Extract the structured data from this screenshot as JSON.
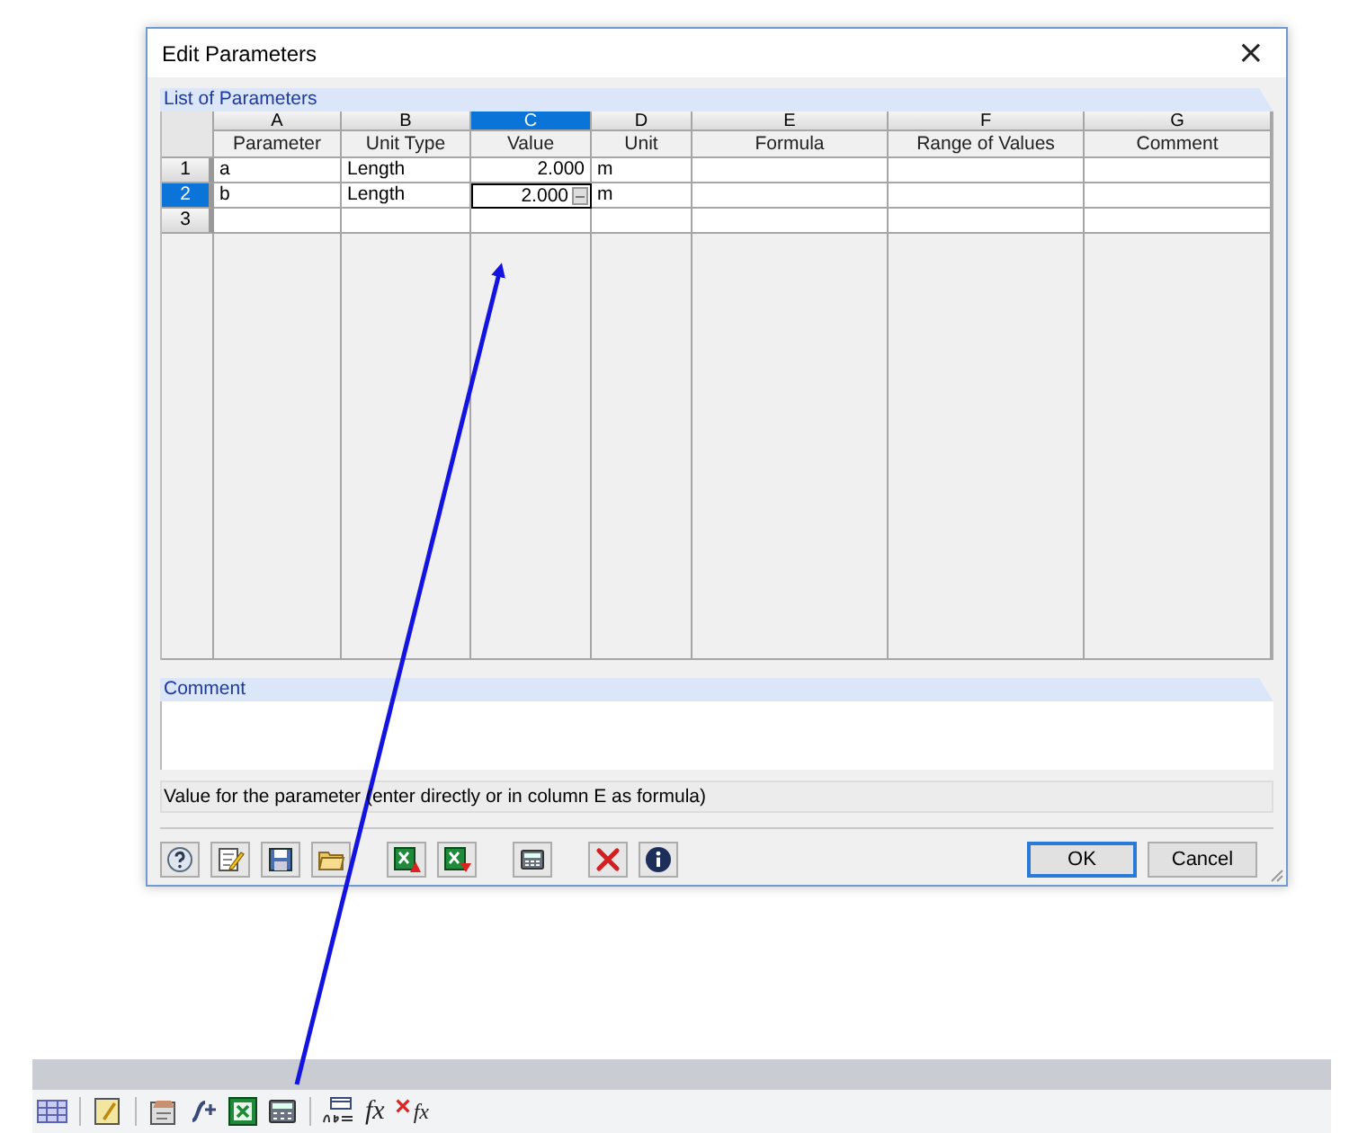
{
  "window": {
    "title": "Edit Parameters",
    "close": "×"
  },
  "list": {
    "title": "List of Parameters",
    "columns": [
      {
        "letter": "A",
        "name": "Parameter",
        "selected": false
      },
      {
        "letter": "B",
        "name": "Unit Type",
        "selected": false
      },
      {
        "letter": "C",
        "name": "Value",
        "selected": true
      },
      {
        "letter": "D",
        "name": "Unit",
        "selected": false
      },
      {
        "letter": "E",
        "name": "Formula",
        "selected": false
      },
      {
        "letter": "F",
        "name": "Range of Values",
        "selected": false
      },
      {
        "letter": "G",
        "name": "Comment",
        "selected": false
      }
    ],
    "rows": [
      {
        "number": "1",
        "selected": false,
        "parameter": "a",
        "unit_type": "Length",
        "value": "2.000",
        "unit": "m"
      },
      {
        "number": "2",
        "selected": true,
        "editing": true,
        "parameter": "b",
        "unit_type": "Length",
        "value": "2.000",
        "unit": "m"
      },
      {
        "number": "3",
        "selected": false
      }
    ]
  },
  "comment": {
    "title": "Comment"
  },
  "status": "Value for the parameter (enter directly or in column E as formula)",
  "buttons": [
    {
      "label": "OK",
      "default": true
    },
    {
      "label": "Cancel",
      "default": false
    }
  ],
  "app_toolbar": {
    "function_buttons": [
      {
        "label": "fx",
        "crossed": false
      },
      {
        "label": "fx",
        "crossed": true
      }
    ]
  }
}
